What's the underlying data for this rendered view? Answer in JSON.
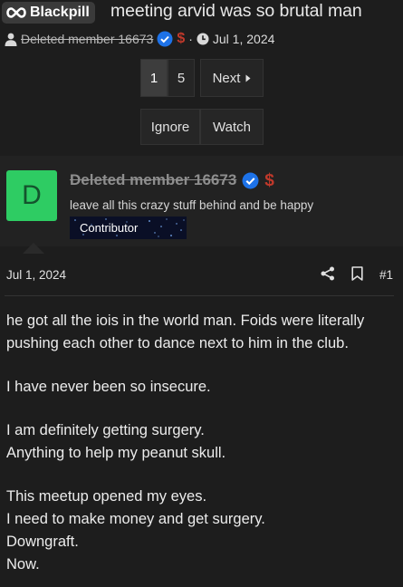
{
  "thread": {
    "prefix": "Blackpill",
    "title": "meeting arvid was so brutal man",
    "author": "Deleted member 16673",
    "separator": "·",
    "date": "Jul 1, 2024"
  },
  "pagination": {
    "pages": [
      "1",
      "5"
    ],
    "active": "1",
    "next_label": "Next"
  },
  "actions": {
    "ignore_label": "Ignore",
    "watch_label": "Watch"
  },
  "post": {
    "avatar_letter": "D",
    "username": "Deleted member 16673",
    "user_title": "leave all this crazy stuff behind and be happy",
    "banner": "Contributor",
    "date": "Jul 1, 2024",
    "number": "#1",
    "body": [
      [
        "he got all the iois in the world man. Foids were literally",
        "pushing each other to dance next to him in the club."
      ],
      [
        "I have never been so insecure."
      ],
      [
        "I am definitely getting surgery.",
        "Anything to help my peanut skull."
      ],
      [
        "This meetup opened my eyes.",
        "I need to make money and get surgery.",
        "Downgraft.",
        "Now."
      ]
    ]
  },
  "icons": {
    "prefix": "infinity-icon",
    "user": "user-icon",
    "verified": "verified-badge-icon",
    "currency": "dollar-icon",
    "clock": "clock-icon",
    "next": "caret-right-icon",
    "share": "share-icon",
    "bookmark": "bookmark-icon"
  },
  "colors": {
    "background": "#1d1d1d",
    "avatar": "#2ecc63",
    "verified": "#1d72e8",
    "dollar": "#c0392b"
  }
}
